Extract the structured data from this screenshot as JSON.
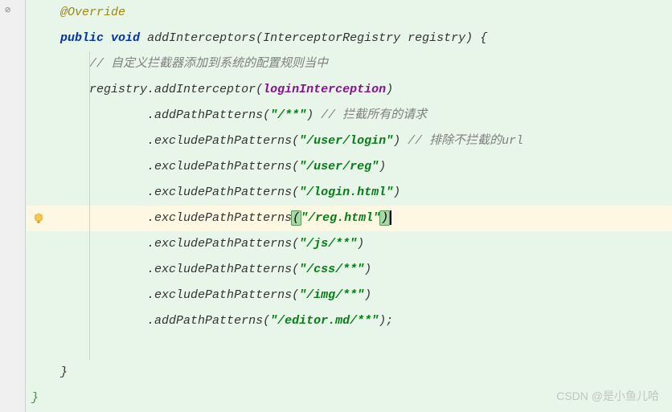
{
  "code": {
    "annotation": "@Override",
    "kw_public": "public",
    "kw_void": "void",
    "method_name": "addInterceptors",
    "param_type": "InterceptorRegistry",
    "param_name": "registry",
    "comment1": "// 自定义拦截器添加到系统的配置规则当中",
    "registry_var": "registry",
    "addInterceptor": "addInterceptor",
    "loginInterception": "loginInterception",
    "addPathPatterns": "addPathPatterns",
    "excludePathPatterns": "excludePathPatterns",
    "str_all": "\"/**\"",
    "comment_all": "// 拦截所有的请求",
    "str_login": "\"/user/login\"",
    "comment_exclude": "// 排除不拦截的url",
    "str_reg": "\"/user/reg\"",
    "str_loginhtml": "\"/login.html\"",
    "str_reghtml": "\"/reg.html\"",
    "str_js": "\"/js/**\"",
    "str_css": "\"/css/**\"",
    "str_img": "\"/img/**\"",
    "str_editor": "\"/editor.md/**\""
  },
  "watermark": "CSDN @是小鱼儿哈"
}
